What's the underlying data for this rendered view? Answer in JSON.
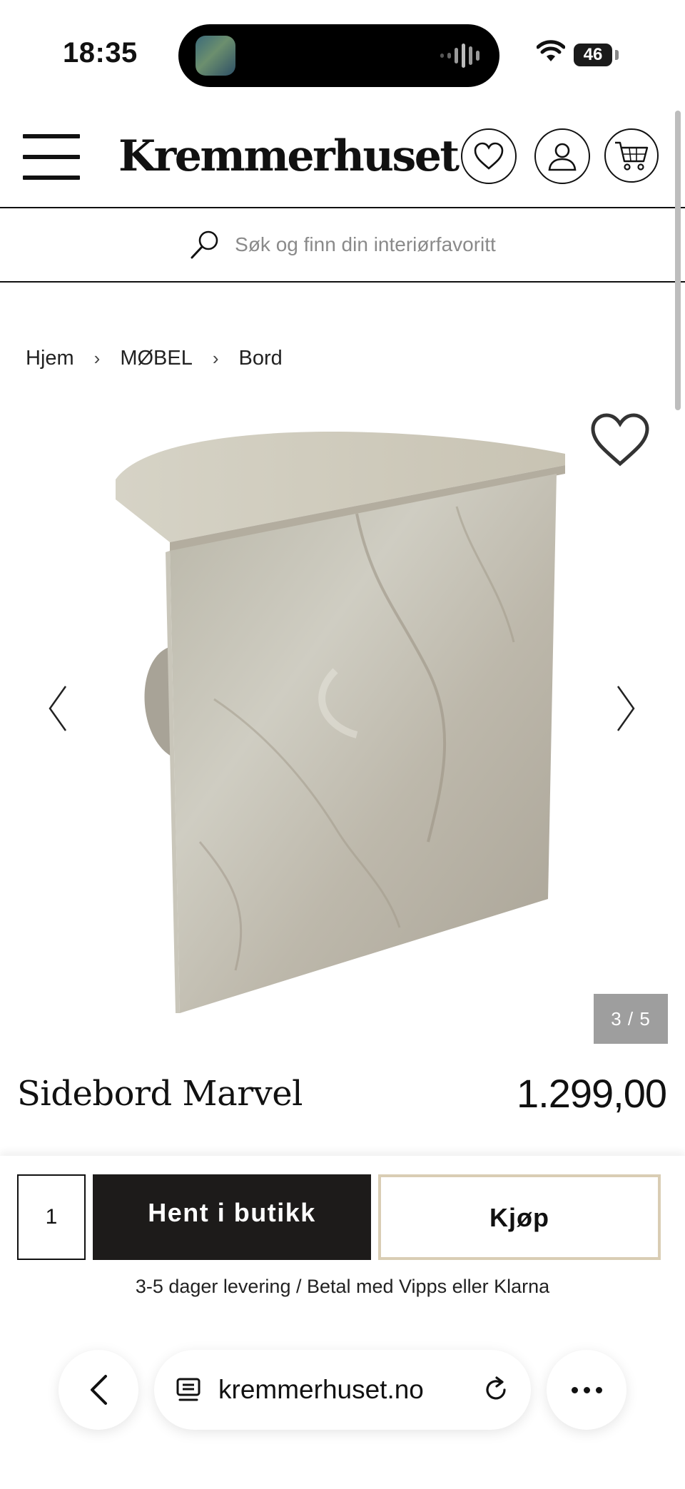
{
  "status_bar": {
    "time": "18:35",
    "battery": "46"
  },
  "header": {
    "logo": "Kremmerhuset",
    "icons": [
      "menu-icon",
      "heart-icon",
      "user-icon",
      "cart-icon"
    ]
  },
  "search": {
    "placeholder": "Søk og finn din interiørfavoritt"
  },
  "breadcrumb": [
    {
      "label": "Hjem"
    },
    {
      "label": "MØBEL"
    },
    {
      "label": "Bord"
    }
  ],
  "gallery": {
    "counter": "3 / 5",
    "current": 3,
    "total": 5
  },
  "product": {
    "title": "Sidebord Marvel",
    "price": "1.299,00"
  },
  "purchase": {
    "quantity": "1",
    "pickup_label": "Hent i butikk",
    "buy_label": "Kjøp",
    "delivery_info": "3-5 dager levering / Betal med Vipps eller Klarna",
    "colors": {
      "pickup_bg": "#1d1b1a",
      "buy_border": "#d9cdb4"
    }
  },
  "browser": {
    "url": "kremmerhuset.no"
  }
}
